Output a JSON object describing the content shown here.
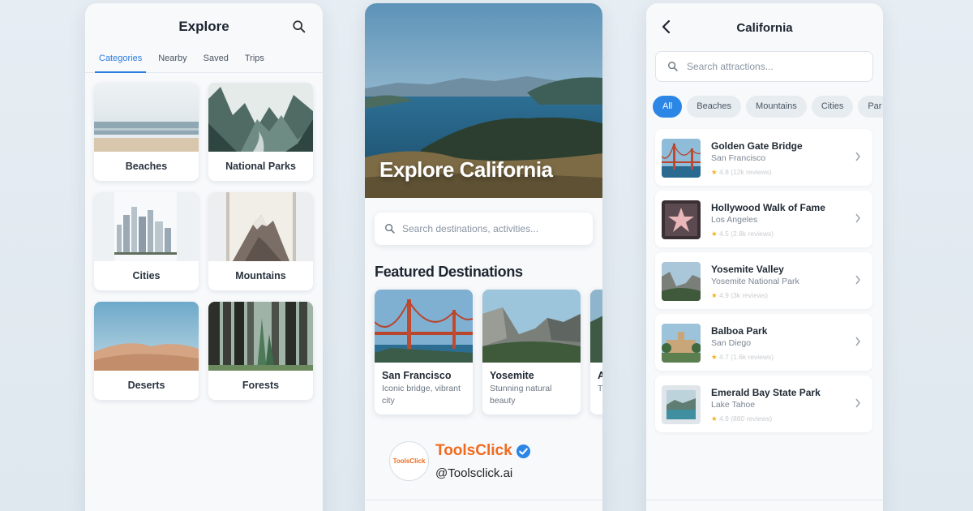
{
  "left": {
    "title": "Explore",
    "tabs": [
      "Categories",
      "Nearby",
      "Saved",
      "Trips"
    ],
    "categories": [
      "Beaches",
      "National Parks",
      "Cities",
      "Mountains",
      "Deserts",
      "Forests"
    ]
  },
  "mid": {
    "hero_title": "Explore California",
    "search_placeholder": "Search destinations, activities...",
    "featured_title": "Featured Destinations",
    "destinations": [
      {
        "name": "San Francisco",
        "desc": "Iconic bridge, vibrant city"
      },
      {
        "name": "Yosemite",
        "desc": "Stunning natural beauty"
      },
      {
        "name": "A",
        "desc": "T a"
      }
    ]
  },
  "brand": {
    "logo_text": "ToolsClick",
    "name": "ToolsClick",
    "handle": "@Toolsclick.ai",
    "color": "#f06a1e",
    "verified_icon": "verified-badge-icon"
  },
  "right": {
    "title": "California",
    "search_placeholder": "Search attractions...",
    "chips": [
      "All",
      "Beaches",
      "Mountains",
      "Cities",
      "Par"
    ],
    "attractions": [
      {
        "name": "Golden Gate Bridge",
        "location": "San Francisco",
        "rating": "4.8 (12k reviews)"
      },
      {
        "name": "Hollywood Walk of Fame",
        "location": "Los Angeles",
        "rating": "4.5 (2.8k reviews)"
      },
      {
        "name": "Yosemite Valley",
        "location": "Yosemite National Park",
        "rating": "4.9 (3k reviews)"
      },
      {
        "name": "Balboa Park",
        "location": "San Diego",
        "rating": "4.7 (1.6k reviews)"
      },
      {
        "name": "Emerald Bay State Park",
        "location": "Lake Tahoe",
        "rating": "4.9 (880 reviews)"
      }
    ]
  },
  "colors": {
    "accent": "#2b86e6",
    "star": "#f2b01e"
  }
}
